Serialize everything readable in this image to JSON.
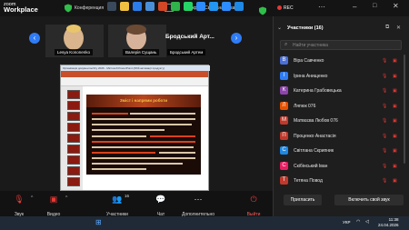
{
  "app": {
    "logo_line1": "zoom",
    "logo_line2": "Workplace"
  },
  "titlebar": {
    "conference_label": "Конференция",
    "screen_label": "Экран (Світлана Коваль)",
    "rec_label": "REC"
  },
  "stage": {
    "videos": [
      {
        "name": "Lesya Kononenko"
      },
      {
        "name": "Валерія Сущань"
      },
      {
        "name": "Бродський Артем"
      }
    ],
    "overflow_name": "Бродський Арт..."
  },
  "ppt": {
    "window_title": "Організація документообігу 2026 - Microsoft PowerPoint (Збій активації продукту)",
    "slide_title": "Зміст і напрями роботи"
  },
  "panel": {
    "title": "Участники (16)",
    "search_placeholder": "Найти участника",
    "participants": [
      {
        "initial": "В",
        "name": "Віра Савченко",
        "color": "#4a6fd8"
      },
      {
        "initial": "І",
        "name": "Ірина Анищенко",
        "color": "#2f7cf6"
      },
      {
        "initial": "К",
        "name": "Катерина Грабовецька",
        "color": "#8e44ad"
      },
      {
        "initial": "Л",
        "name": "Ляпюк 076",
        "color": "#e65100"
      },
      {
        "initial": "М",
        "name": "Матвєєва Любов 076",
        "color": "#c0392b"
      },
      {
        "initial": "П",
        "name": "Проценко Анастасія",
        "color": "#c0392b"
      },
      {
        "initial": "С",
        "name": "Світлана Скрипник",
        "color": "#1e88e5"
      },
      {
        "initial": "С",
        "name": "Скібінський Іван",
        "color": "#e91e63"
      },
      {
        "initial": "Т",
        "name": "Тетяна Повод",
        "color": "#c0392b"
      }
    ],
    "invite_label": "Пригласить",
    "unmute_all_label": "Включить свой звук"
  },
  "toolbar": {
    "audio": "Звук",
    "video": "Видео",
    "participants": "Участники",
    "participants_count": "16",
    "chat": "Чат",
    "more": "Дополнительно",
    "leave": "Выйти"
  },
  "taskbar": {
    "lang": "УКР",
    "time": "11:38",
    "date": "24.04.2026"
  }
}
